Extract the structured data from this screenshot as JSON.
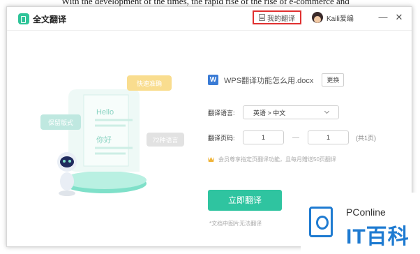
{
  "background_text": "With the development of the times, the rapid rise of the rise of e-commerce and",
  "window": {
    "app_title": "全文翻译",
    "my_translation": "我的翻译",
    "user_name": "Kaili爱编",
    "minimize": "—",
    "close": "✕"
  },
  "illustration": {
    "tag_fast": "快速准确",
    "tag_format": "保留版式",
    "tag_langs": "72种语言",
    "hello": "Hello",
    "nihao": "你好"
  },
  "file": {
    "badge": "W",
    "name": "WPS翻译功能怎么用.docx",
    "change_button": "更换"
  },
  "language": {
    "label": "翻译语言:",
    "value": "英语 > 中文"
  },
  "pages": {
    "label": "翻译页码:",
    "from": "1",
    "dash": "—",
    "to": "1",
    "total": "(共1页)"
  },
  "vip_note": "会员尊享指定页翻译功能，且每月赠送50页翻译",
  "translate_button": "立即翻译",
  "footnote": "*文档中图片无法翻译",
  "watermark": {
    "top": "PConline",
    "big": "IT百科"
  },
  "colors": {
    "accent": "#2fc4a0",
    "highlight_border": "#e03030",
    "tag_yellow": "#f9dd8f",
    "tag_teal": "#bfe8e0",
    "robot_eye": "#1f2a5c"
  }
}
